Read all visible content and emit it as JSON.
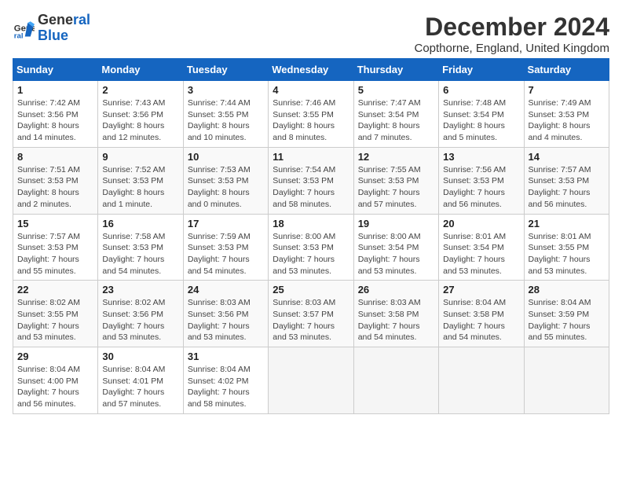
{
  "logo": {
    "line1": "General",
    "line2": "Blue"
  },
  "title": "December 2024",
  "subtitle": "Copthorne, England, United Kingdom",
  "headers": [
    "Sunday",
    "Monday",
    "Tuesday",
    "Wednesday",
    "Thursday",
    "Friday",
    "Saturday"
  ],
  "weeks": [
    [
      {
        "day": "1",
        "sunrise": "7:42 AM",
        "sunset": "3:56 PM",
        "daylight": "8 hours and 14 minutes."
      },
      {
        "day": "2",
        "sunrise": "7:43 AM",
        "sunset": "3:56 PM",
        "daylight": "8 hours and 12 minutes."
      },
      {
        "day": "3",
        "sunrise": "7:44 AM",
        "sunset": "3:55 PM",
        "daylight": "8 hours and 10 minutes."
      },
      {
        "day": "4",
        "sunrise": "7:46 AM",
        "sunset": "3:55 PM",
        "daylight": "8 hours and 8 minutes."
      },
      {
        "day": "5",
        "sunrise": "7:47 AM",
        "sunset": "3:54 PM",
        "daylight": "8 hours and 7 minutes."
      },
      {
        "day": "6",
        "sunrise": "7:48 AM",
        "sunset": "3:54 PM",
        "daylight": "8 hours and 5 minutes."
      },
      {
        "day": "7",
        "sunrise": "7:49 AM",
        "sunset": "3:53 PM",
        "daylight": "8 hours and 4 minutes."
      }
    ],
    [
      {
        "day": "8",
        "sunrise": "7:51 AM",
        "sunset": "3:53 PM",
        "daylight": "8 hours and 2 minutes."
      },
      {
        "day": "9",
        "sunrise": "7:52 AM",
        "sunset": "3:53 PM",
        "daylight": "8 hours and 1 minute."
      },
      {
        "day": "10",
        "sunrise": "7:53 AM",
        "sunset": "3:53 PM",
        "daylight": "8 hours and 0 minutes."
      },
      {
        "day": "11",
        "sunrise": "7:54 AM",
        "sunset": "3:53 PM",
        "daylight": "7 hours and 58 minutes."
      },
      {
        "day": "12",
        "sunrise": "7:55 AM",
        "sunset": "3:53 PM",
        "daylight": "7 hours and 57 minutes."
      },
      {
        "day": "13",
        "sunrise": "7:56 AM",
        "sunset": "3:53 PM",
        "daylight": "7 hours and 56 minutes."
      },
      {
        "day": "14",
        "sunrise": "7:57 AM",
        "sunset": "3:53 PM",
        "daylight": "7 hours and 56 minutes."
      }
    ],
    [
      {
        "day": "15",
        "sunrise": "7:57 AM",
        "sunset": "3:53 PM",
        "daylight": "7 hours and 55 minutes."
      },
      {
        "day": "16",
        "sunrise": "7:58 AM",
        "sunset": "3:53 PM",
        "daylight": "7 hours and 54 minutes."
      },
      {
        "day": "17",
        "sunrise": "7:59 AM",
        "sunset": "3:53 PM",
        "daylight": "7 hours and 54 minutes."
      },
      {
        "day": "18",
        "sunrise": "8:00 AM",
        "sunset": "3:53 PM",
        "daylight": "7 hours and 53 minutes."
      },
      {
        "day": "19",
        "sunrise": "8:00 AM",
        "sunset": "3:54 PM",
        "daylight": "7 hours and 53 minutes."
      },
      {
        "day": "20",
        "sunrise": "8:01 AM",
        "sunset": "3:54 PM",
        "daylight": "7 hours and 53 minutes."
      },
      {
        "day": "21",
        "sunrise": "8:01 AM",
        "sunset": "3:55 PM",
        "daylight": "7 hours and 53 minutes."
      }
    ],
    [
      {
        "day": "22",
        "sunrise": "8:02 AM",
        "sunset": "3:55 PM",
        "daylight": "7 hours and 53 minutes."
      },
      {
        "day": "23",
        "sunrise": "8:02 AM",
        "sunset": "3:56 PM",
        "daylight": "7 hours and 53 minutes."
      },
      {
        "day": "24",
        "sunrise": "8:03 AM",
        "sunset": "3:56 PM",
        "daylight": "7 hours and 53 minutes."
      },
      {
        "day": "25",
        "sunrise": "8:03 AM",
        "sunset": "3:57 PM",
        "daylight": "7 hours and 53 minutes."
      },
      {
        "day": "26",
        "sunrise": "8:03 AM",
        "sunset": "3:58 PM",
        "daylight": "7 hours and 54 minutes."
      },
      {
        "day": "27",
        "sunrise": "8:04 AM",
        "sunset": "3:58 PM",
        "daylight": "7 hours and 54 minutes."
      },
      {
        "day": "28",
        "sunrise": "8:04 AM",
        "sunset": "3:59 PM",
        "daylight": "7 hours and 55 minutes."
      }
    ],
    [
      {
        "day": "29",
        "sunrise": "8:04 AM",
        "sunset": "4:00 PM",
        "daylight": "7 hours and 56 minutes."
      },
      {
        "day": "30",
        "sunrise": "8:04 AM",
        "sunset": "4:01 PM",
        "daylight": "7 hours and 57 minutes."
      },
      {
        "day": "31",
        "sunrise": "8:04 AM",
        "sunset": "4:02 PM",
        "daylight": "7 hours and 58 minutes."
      },
      null,
      null,
      null,
      null
    ]
  ]
}
